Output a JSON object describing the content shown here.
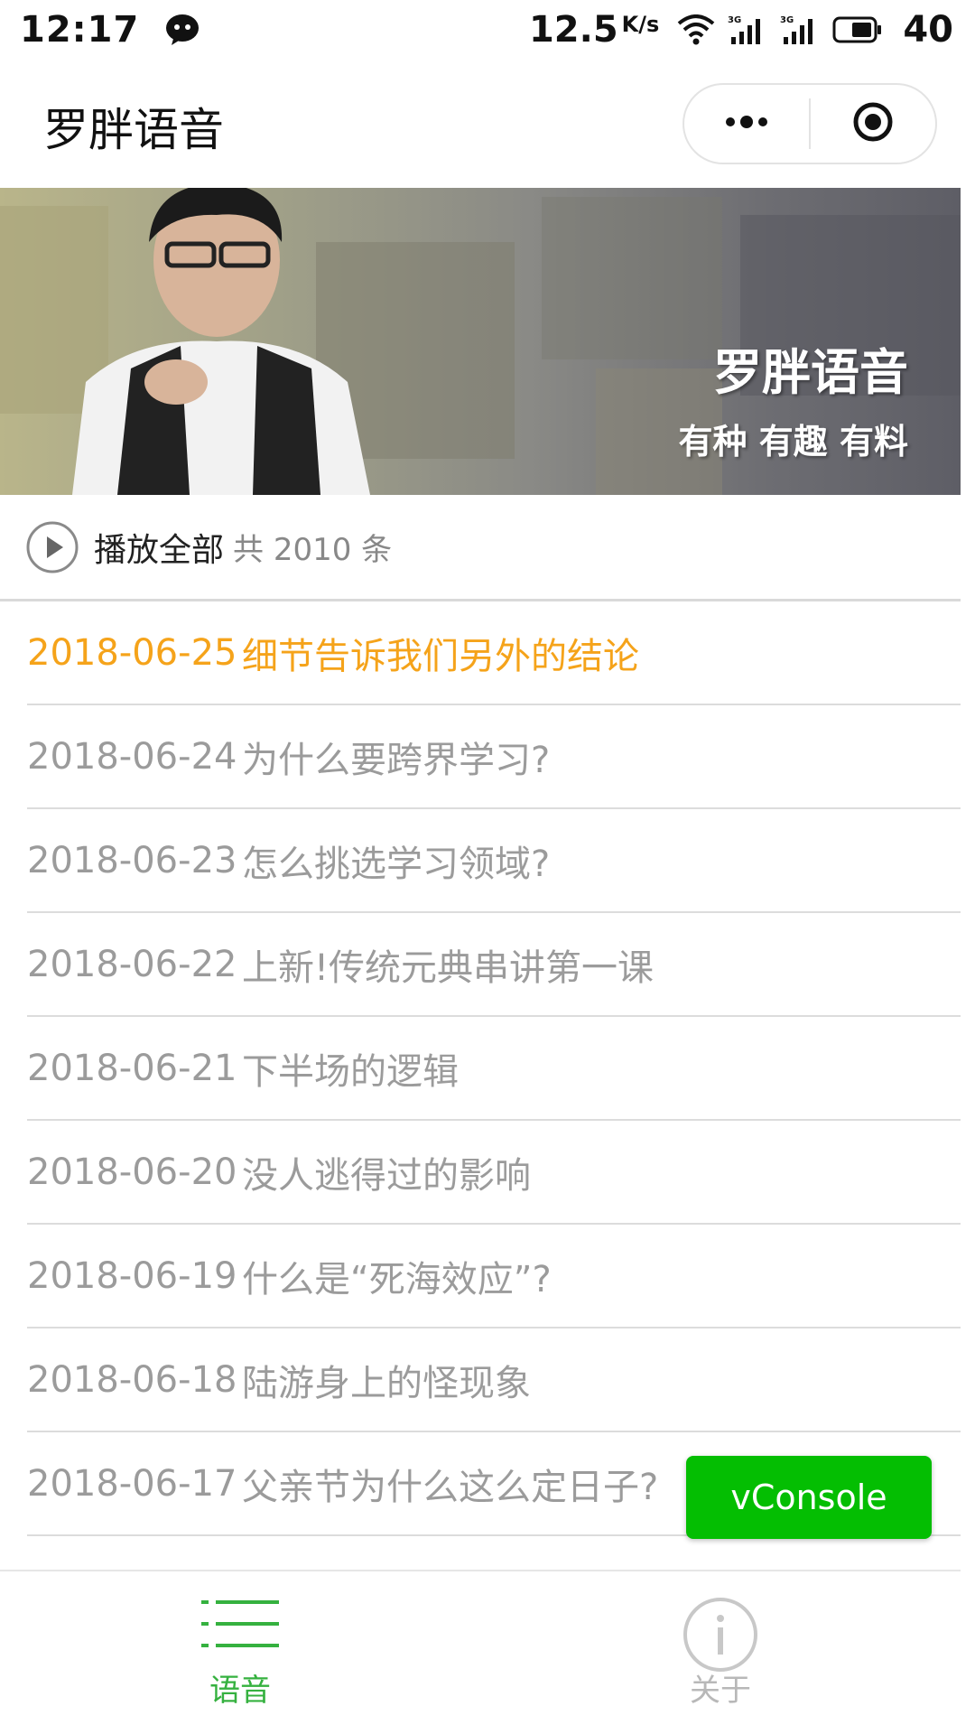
{
  "status_bar": {
    "time": "12:17",
    "speed": "12.5",
    "speed_unit": "K/s",
    "network_1": "3G",
    "network_2": "3G",
    "battery": "40"
  },
  "nav": {
    "title": "罗胖语音",
    "more_icon": "more-dots-icon",
    "close_icon": "target-close-icon"
  },
  "banner": {
    "title": "罗胖语音",
    "subtitle": "有种 有趣 有料"
  },
  "play_all": {
    "label": "播放全部",
    "count": "共 2010 条"
  },
  "episodes": [
    {
      "date": "2018-06-25",
      "title": "细节告诉我们另外的结论",
      "active": true
    },
    {
      "date": "2018-06-24",
      "title": "为什么要跨界学习?",
      "active": false
    },
    {
      "date": "2018-06-23",
      "title": "怎么挑选学习领域?",
      "active": false
    },
    {
      "date": "2018-06-22",
      "title": "上新!传统元典串讲第一课",
      "active": false
    },
    {
      "date": "2018-06-21",
      "title": "下半场的逻辑",
      "active": false
    },
    {
      "date": "2018-06-20",
      "title": "没人逃得过的影响",
      "active": false
    },
    {
      "date": "2018-06-19",
      "title": "什么是“死海效应”?",
      "active": false
    },
    {
      "date": "2018-06-18",
      "title": "陆游身上的怪现象",
      "active": false
    },
    {
      "date": "2018-06-17",
      "title": "父亲节为什么这么定日子?",
      "active": false
    }
  ],
  "vconsole": {
    "label": "vConsole"
  },
  "tabbar": {
    "tabs": [
      {
        "label": "语音",
        "icon": "list-icon",
        "active": true
      },
      {
        "label": "关于",
        "icon": "info-icon",
        "active": false
      }
    ]
  },
  "colors": {
    "active_text": "#f5a31a",
    "inactive_text": "#9b9b9b",
    "tab_active": "#35b13f",
    "vconsole_bg": "#04be02"
  }
}
